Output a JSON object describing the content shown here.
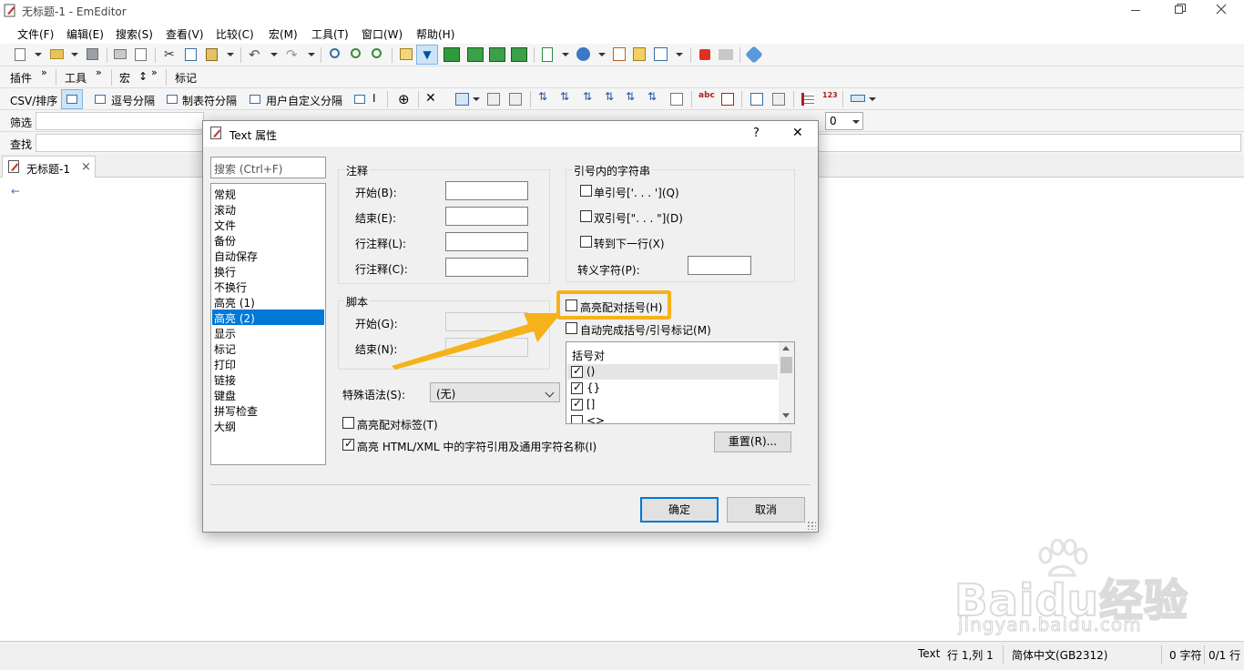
{
  "window": {
    "title": "无标题-1 - EmEditor",
    "restore_icon": "restore-icon",
    "close_icon": "close-icon"
  },
  "menu": [
    "文件(F)",
    "编辑(E)",
    "搜索(S)",
    "查看(V)",
    "比较(C)",
    "宏(M)",
    "工具(T)",
    "窗口(W)",
    "帮助(H)"
  ],
  "toolbar2": {
    "plugins": "插件",
    "tools": "工具",
    "macro": "宏",
    "macro_suffix": "↕",
    "marks": "标记",
    "overflow": "»"
  },
  "csv_bar": {
    "label": "CSV/排序",
    "comma": "逗号分隔",
    "tab": "制表符分隔",
    "user": "用户自定义分隔",
    "mark": "I"
  },
  "filter_bar": {
    "label": "筛选",
    "dropdown_value": "0"
  },
  "find_bar": {
    "label": "查找"
  },
  "tabs": [
    {
      "label": "无标题-1",
      "close": "×"
    }
  ],
  "editor": {
    "eol_mark": "←"
  },
  "dialog": {
    "title": "Text 属性",
    "help": "?",
    "close": "✕",
    "search_placeholder": "搜索 (Ctrl+F)",
    "categories": [
      "常规",
      "滚动",
      "文件",
      "备份",
      "自动保存",
      "换行",
      "不换行",
      "高亮 (1)",
      "高亮 (2)",
      "显示",
      "标记",
      "打印",
      "链接",
      "键盘",
      "拼写检查",
      "大纲"
    ],
    "selected_category": "高亮 (2)",
    "comment": {
      "title": "注释",
      "begin": "开始(B):",
      "end": "结束(E):",
      "line1": "行注释(L):",
      "line2": "行注释(C):"
    },
    "script": {
      "title": "脚本",
      "begin": "开始(G):",
      "end": "结束(N):"
    },
    "quotes": {
      "title": "引号内的字符串",
      "single": "单引号['. . . '](Q)",
      "double": "双引号[\". . . \"](D)",
      "next_line": "转到下一行(X)",
      "escape": "转义字符(P):"
    },
    "highlight_brackets": "高亮配对括号(H)",
    "auto_complete": "自动完成括号/引号标记(M)",
    "bracket_list": {
      "header": "括号对",
      "items": [
        {
          "text": "()",
          "checked": true
        },
        {
          "text": "{}",
          "checked": true
        },
        {
          "text": "[]",
          "checked": true
        },
        {
          "text": "<>",
          "checked": false
        }
      ]
    },
    "special_syntax": {
      "label": "特殊语法(S):",
      "value": "(无)"
    },
    "highlight_tags": "高亮配对标签(T)",
    "highlight_html": "高亮 HTML/XML 中的字符引用及通用字符名称(I)",
    "reset": "重置(R)...",
    "ok": "确定",
    "cancel": "取消"
  },
  "status": {
    "type": "Text",
    "position": "行 1,列 1",
    "encoding": "简体中文(GB2312)",
    "chars": "0 字符",
    "lines": "0/1 行"
  },
  "watermark": {
    "brand": "Baidu经验",
    "url": "jingyan.baidu.com"
  },
  "colors": {
    "accent": "#0078d7",
    "highlight_box": "#f5b21a",
    "arrow": "#f5b21a",
    "selection": "#0078d7"
  }
}
